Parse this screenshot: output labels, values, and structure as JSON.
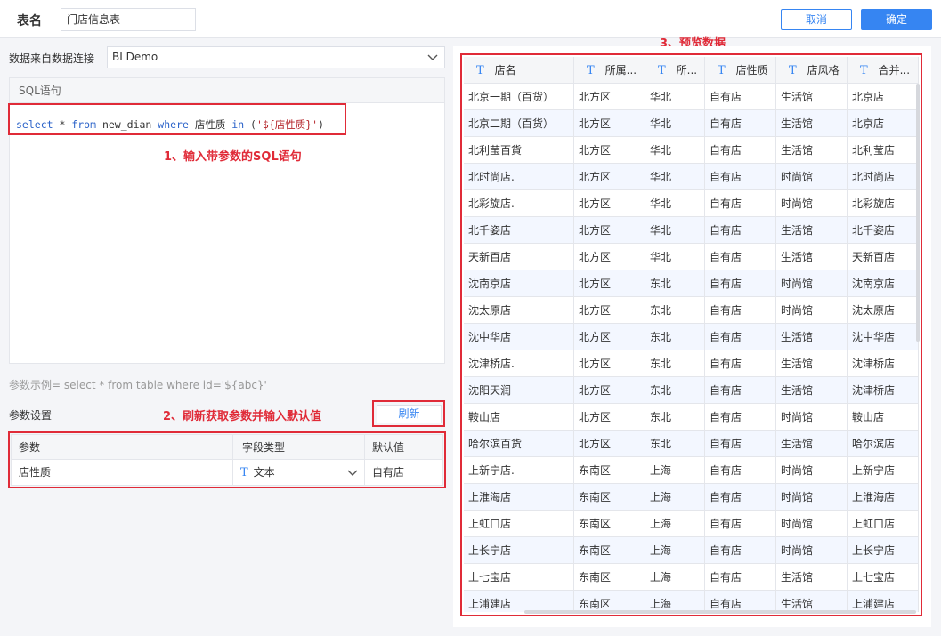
{
  "header": {
    "table_name_label": "表名",
    "table_name_value": "门店信息表",
    "cancel_label": "取消",
    "ok_label": "确定"
  },
  "connection": {
    "label": "数据来自数据连接",
    "value": "BI Demo"
  },
  "sql": {
    "header": "SQL语句",
    "kw_select": "select",
    "text_1": " * ",
    "kw_from": "from",
    "text_2": " new_dian ",
    "kw_where": "where",
    "text_3": " 店性质 ",
    "kw_in": "in",
    "text_4": " (",
    "param_str": "'${店性质}'",
    "text_5": ")"
  },
  "annotations": {
    "step1": "1、输入带参数的SQL语句",
    "step2": "2、刷新获取参数并输入默认值",
    "step3": "3、预览数据"
  },
  "params": {
    "hint": "参数示例= select * from table where id='${abc}'",
    "title": "参数设置",
    "refresh_label": "刷新",
    "columns": [
      "参数",
      "字段类型",
      "默认值"
    ],
    "rows": [
      {
        "name": "店性质",
        "type": "文本",
        "default": "自有店"
      }
    ]
  },
  "preview": {
    "columns": [
      "店名",
      "所属...",
      "所...",
      "店性质",
      "店风格",
      "合并..."
    ],
    "rows": [
      [
        "北京一期（百货）",
        "北方区",
        "华北",
        "自有店",
        "生活馆",
        "北京店"
      ],
      [
        "北京二期（百货）",
        "北方区",
        "华北",
        "自有店",
        "生活馆",
        "北京店"
      ],
      [
        "北利莹百貨",
        "北方区",
        "华北",
        "自有店",
        "生活馆",
        "北利莹店"
      ],
      [
        "北时尚店.",
        "北方区",
        "华北",
        "自有店",
        "时尚馆",
        "北时尚店"
      ],
      [
        "北彩旋店.",
        "北方区",
        "华北",
        "自有店",
        "时尚馆",
        "北彩旋店"
      ],
      [
        "北千姿店",
        "北方区",
        "华北",
        "自有店",
        "生活馆",
        "北千姿店"
      ],
      [
        "天新百店",
        "北方区",
        "华北",
        "自有店",
        "生活馆",
        "天新百店"
      ],
      [
        "沈南京店",
        "北方区",
        "东北",
        "自有店",
        "时尚馆",
        "沈南京店"
      ],
      [
        "沈太原店",
        "北方区",
        "东北",
        "自有店",
        "时尚馆",
        "沈太原店"
      ],
      [
        "沈中华店",
        "北方区",
        "东北",
        "自有店",
        "生活馆",
        "沈中华店"
      ],
      [
        "沈津桥店.",
        "北方区",
        "东北",
        "自有店",
        "生活馆",
        "沈津桥店"
      ],
      [
        "沈阳天润",
        "北方区",
        "东北",
        "自有店",
        "生活馆",
        "沈津桥店"
      ],
      [
        "鞍山店",
        "北方区",
        "东北",
        "自有店",
        "时尚馆",
        "鞍山店"
      ],
      [
        "哈尔滨百货",
        "北方区",
        "东北",
        "自有店",
        "生活馆",
        "哈尔滨店"
      ],
      [
        "上新宁店.",
        "东南区",
        "上海",
        "自有店",
        "时尚馆",
        "上新宁店"
      ],
      [
        "上淮海店",
        "东南区",
        "上海",
        "自有店",
        "时尚馆",
        "上淮海店"
      ],
      [
        "上虹口店",
        "东南区",
        "上海",
        "自有店",
        "时尚馆",
        "上虹口店"
      ],
      [
        "上长宁店",
        "东南区",
        "上海",
        "自有店",
        "时尚馆",
        "上长宁店"
      ],
      [
        "上七宝店",
        "东南区",
        "上海",
        "自有店",
        "生活馆",
        "上七宝店"
      ],
      [
        "上浦建店",
        "东南区",
        "上海",
        "自有店",
        "生活馆",
        "上浦建店"
      ]
    ]
  },
  "colors": {
    "accent": "#3685f2",
    "annotation_red": "#e02b38"
  }
}
